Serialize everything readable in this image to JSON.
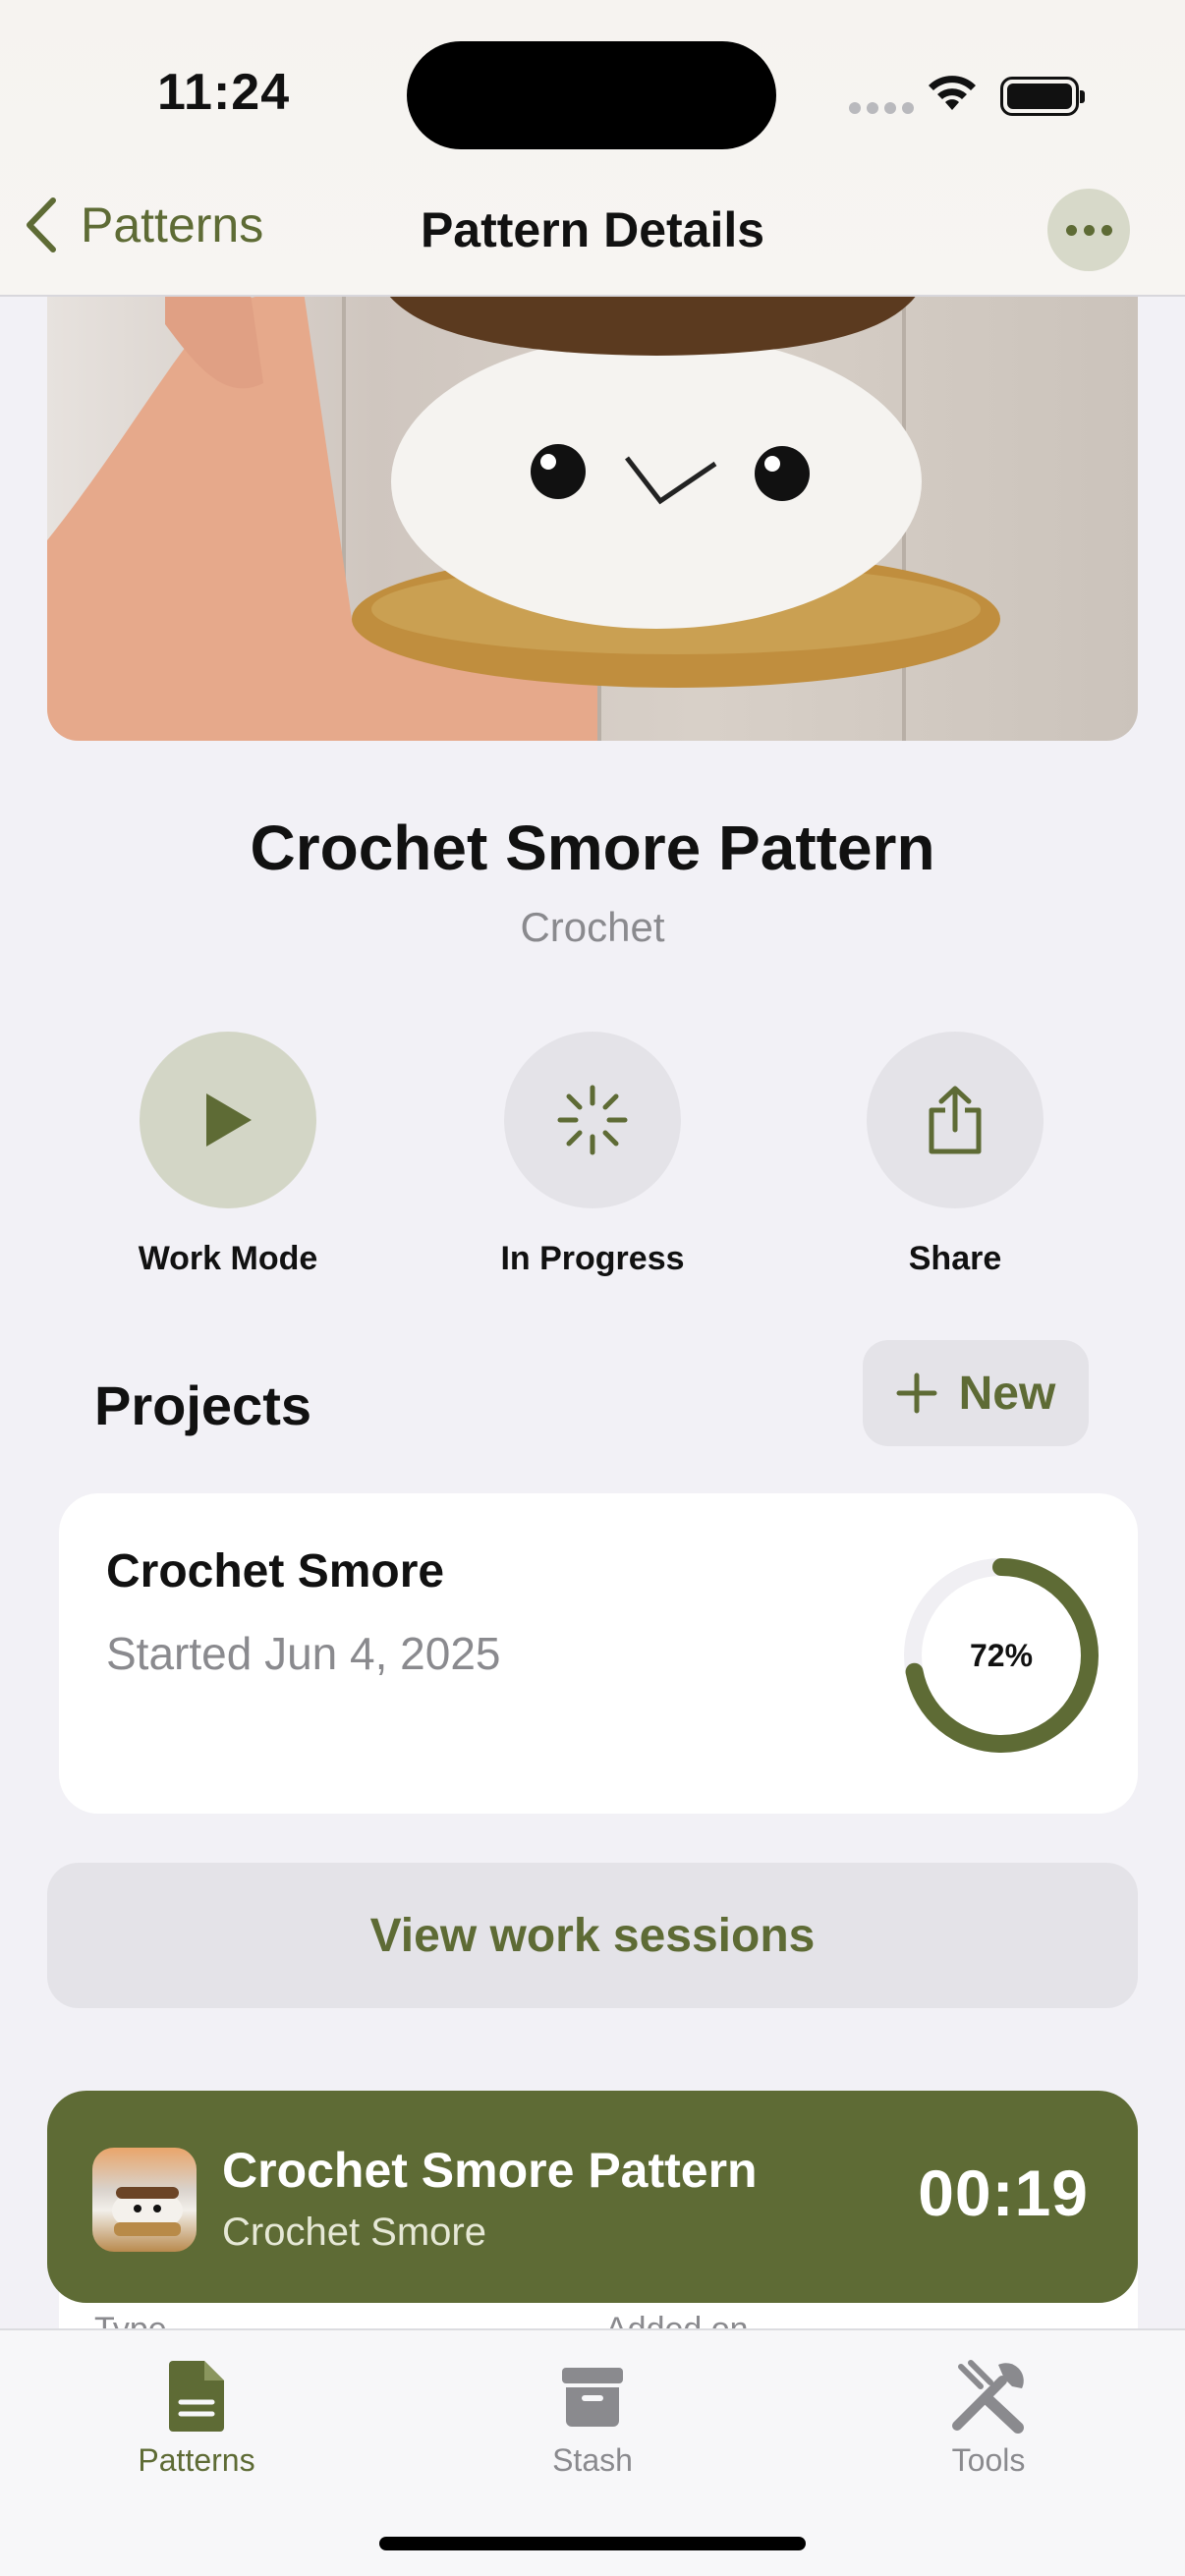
{
  "status": {
    "time": "11:24"
  },
  "nav": {
    "back_label": "Patterns",
    "title": "Pattern Details"
  },
  "pattern": {
    "title": "Crochet Smore Pattern",
    "craft": "Crochet"
  },
  "actions": [
    {
      "label": "Work Mode",
      "icon": "play-icon"
    },
    {
      "label": "In Progress",
      "icon": "progress-spinner-icon"
    },
    {
      "label": "Share",
      "icon": "share-icon"
    }
  ],
  "projects": {
    "heading": "Projects",
    "new_label": "New",
    "items": [
      {
        "name": "Crochet Smore",
        "started": "Started Jun 4, 2025",
        "progress_label": "72%",
        "progress": 0.72
      }
    ]
  },
  "view_sessions_label": "View work sessions",
  "details_peek": {
    "type_label": "Type",
    "added_label": "Added on"
  },
  "timer": {
    "pattern": "Crochet Smore Pattern",
    "project": "Crochet Smore",
    "elapsed": "00:19"
  },
  "tabs": [
    {
      "label": "Patterns",
      "icon": "document-icon",
      "active": true
    },
    {
      "label": "Stash",
      "icon": "archive-box-icon",
      "active": false
    },
    {
      "label": "Tools",
      "icon": "tools-icon",
      "active": false
    }
  ],
  "colors": {
    "accent": "#5e6b35",
    "accent_light": "#d7d9c9",
    "background": "#f2f1f6",
    "secondary_text": "#8a8a8e"
  }
}
